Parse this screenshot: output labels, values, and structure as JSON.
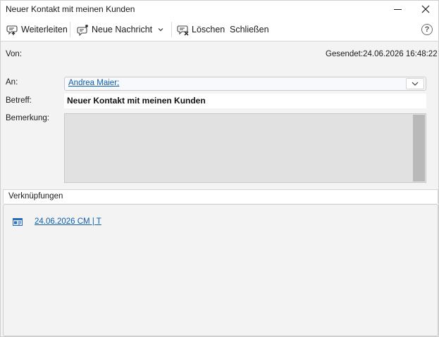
{
  "window": {
    "title": "Neuer Kontakt mit meinen Kunden",
    "controls": {
      "minimize_icon": "minimize-icon",
      "close_icon": "close-icon"
    }
  },
  "toolbar": {
    "forward_label": "Weiterleiten",
    "new_message_label": "Neue Nachricht",
    "delete_label": "Löschen",
    "close_label": "Schließen",
    "help_label": "?"
  },
  "form": {
    "from_label": "Von:",
    "sent_label": "Gesendet:",
    "sent_value": "24.06.2026 16:48:22",
    "to_label": "An:",
    "to_value": "Andrea Maier;",
    "subject_label": "Betreff:",
    "subject_value": "Neuer Kontakt mit meinen Kunden",
    "remark_label": "Bemerkung:",
    "remark_value": ""
  },
  "links": {
    "header": "Verknüpfungen",
    "items": [
      {
        "label": "24.06.2026 CM | T",
        "icon": "appointment-card-icon"
      }
    ]
  },
  "colors": {
    "link": "#0f5ea8",
    "toolbar_bg": "#ffffff",
    "window_bg": "#f3f3f3",
    "remark_bg": "#e1e1e1"
  }
}
